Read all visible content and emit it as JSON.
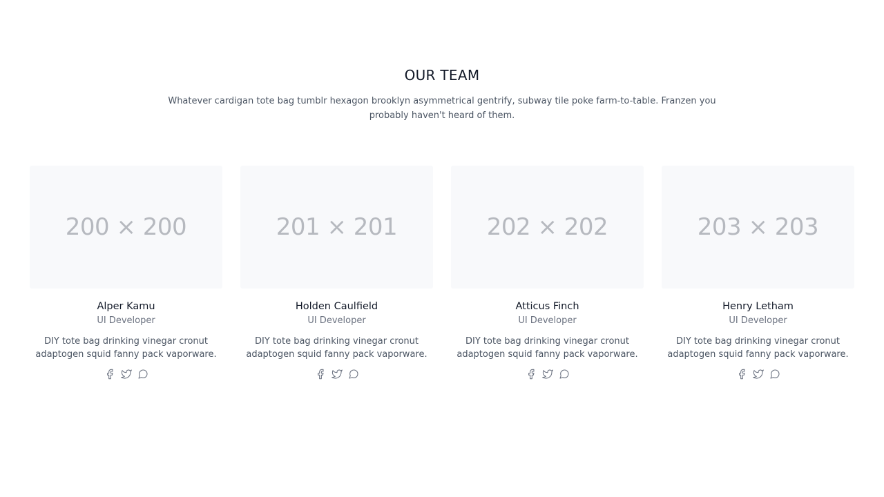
{
  "section": {
    "title": "OUR TEAM",
    "subtitle": "Whatever cardigan tote bag tumblr hexagon brooklyn asymmetrical gentrify, subway tile poke farm-to-table. Franzen you probably haven't heard of them."
  },
  "team": [
    {
      "photo_label": "200 × 200",
      "name": "Alper Kamu",
      "role": "UI Developer",
      "bio": "DIY tote bag drinking vinegar cronut adaptogen squid fanny pack vaporware."
    },
    {
      "photo_label": "201 × 201",
      "name": "Holden Caulfield",
      "role": "UI Developer",
      "bio": "DIY tote bag drinking vinegar cronut adaptogen squid fanny pack vaporware."
    },
    {
      "photo_label": "202 × 202",
      "name": "Atticus Finch",
      "role": "UI Developer",
      "bio": "DIY tote bag drinking vinegar cronut adaptogen squid fanny pack vaporware."
    },
    {
      "photo_label": "203 × 203",
      "name": "Henry Letham",
      "role": "UI Developer",
      "bio": "DIY tote bag drinking vinegar cronut adaptogen squid fanny pack vaporware."
    }
  ],
  "social_icons": [
    "facebook-icon",
    "twitter-icon",
    "chat-icon"
  ],
  "colors": {
    "heading": "#111827",
    "body_text": "#4b5563",
    "muted_text": "#6b7280",
    "photo_bg": "#f8f9fb",
    "photo_label": "#b6b9bf"
  }
}
